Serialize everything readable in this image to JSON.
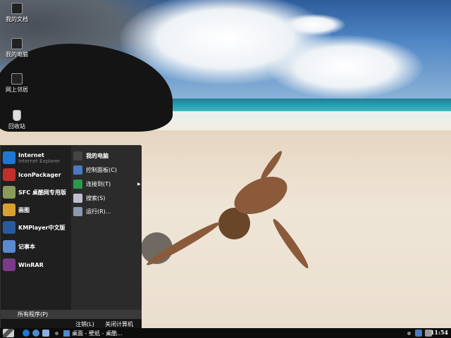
{
  "desktop": {
    "icons": [
      {
        "label": "我的文档",
        "icon": "my-documents-icon"
      },
      {
        "label": "我的电脑",
        "icon": "my-computer-icon"
      },
      {
        "label": "网上邻居",
        "icon": "network-places-icon"
      },
      {
        "label": "回收站",
        "icon": "recycle-bin-icon"
      }
    ]
  },
  "start_menu": {
    "pinned": [
      {
        "title": "Internet",
        "subtitle": "Internet Explorer",
        "icon": "internet-explorer-icon",
        "color": "#1e78d2"
      },
      {
        "title": "IconPackager",
        "icon": "iconpackager-icon",
        "color": "#c0302a"
      },
      {
        "title": "SFC 桌酷网专用版",
        "icon": "sfc-icon",
        "color": "#8a9a5a"
      },
      {
        "title": "画图",
        "icon": "paint-icon",
        "color": "#d8a030"
      },
      {
        "title": "KMPlayer中文版",
        "icon": "kmplayer-icon",
        "color": "#2a5a9a"
      },
      {
        "title": "记事本",
        "icon": "notepad-icon",
        "color": "#5a8ad0"
      },
      {
        "title": "WinRAR",
        "icon": "winrar-icon",
        "color": "#7a3a8a"
      }
    ],
    "right": [
      {
        "label": "我的电脑",
        "icon": "my-computer-icon",
        "color": "#444"
      },
      {
        "label": "控制面板(C)",
        "icon": "control-panel-icon",
        "color": "#4a7ac0"
      },
      {
        "label": "连接到(T)",
        "icon": "connect-to-icon",
        "color": "#2a9a4a",
        "submenu": true
      },
      {
        "label": "搜索(S)",
        "icon": "search-icon",
        "color": "#c0c0d0"
      },
      {
        "label": "运行(R)...",
        "icon": "run-icon",
        "color": "#8a9ab0"
      }
    ],
    "all_programs": "所有程序(P)",
    "logoff": "注销(L)",
    "shutdown": "关闭计算机(U)"
  },
  "taskbar": {
    "task": "桌面 - 壁纸 - 桌酷...",
    "clock": "11:54"
  }
}
